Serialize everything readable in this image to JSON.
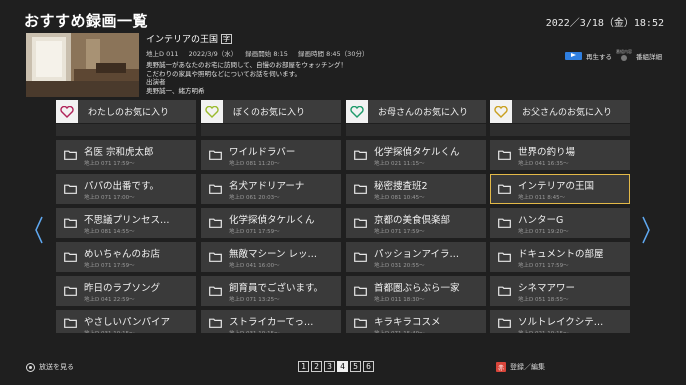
{
  "header": {
    "title": "おすすめ録画一覧",
    "datetime": "2022／3/18（金）18:52"
  },
  "program": {
    "title": "インテリアの王国",
    "badge": "字",
    "channel": "地上D 011",
    "date": "2022/3/9（水）",
    "start": "録画開始 8:15",
    "end": "録画時間 8:45（30分）",
    "desc": [
      "奥野誠一があなたのお宅に訪問して、自慢のお部屋をウォッチング！",
      "こだわりの家具や照明などについてお話を伺います。",
      "出演者",
      "奥野誠一、緒方明希"
    ]
  },
  "actions": {
    "play_label": "再生する",
    "sub_small": "番組内容",
    "detail_label": "番組詳細"
  },
  "columns": [
    {
      "header": "わたしのお気に入り",
      "heart_color": "#b0245a",
      "items": [
        {
          "name": "名医 宗和虎太郎",
          "sub": "地上D 071 17:59～"
        },
        {
          "name": "パパの出番です。",
          "sub": "地上D 071 17:00～"
        },
        {
          "name": "不思議プリンセス…",
          "sub": "地上D 081 14:55～"
        },
        {
          "name": "めいちゃんのお店",
          "sub": "地上D 071 17:59～"
        },
        {
          "name": "昨日のラブソング",
          "sub": "地上D 041 22:59～"
        },
        {
          "name": "やさしいパンパイア",
          "sub": "地上D 031 10:15～"
        }
      ]
    },
    {
      "header": "ぼくのお気に入り",
      "heart_color": "#9bbb2e",
      "items": [
        {
          "name": "ワイルドラバー",
          "sub": "地上D 081 11:20～"
        },
        {
          "name": "名犬アドリアーナ",
          "sub": "地上D 061 20:03～"
        },
        {
          "name": "化学探偵タケルくん",
          "sub": "地上D 071 17:59～"
        },
        {
          "name": "無敵マシーン レッ…",
          "sub": "地上D 041 16:00～"
        },
        {
          "name": "飼育員でございます。",
          "sub": "地上D 071 13:25～"
        },
        {
          "name": "ストライカーてっ…",
          "sub": "地上D 031 10:15～"
        }
      ]
    },
    {
      "header": "お母さんのお気に入り",
      "heart_color": "#1e9a6a",
      "items": [
        {
          "name": "化学探偵タケルくん",
          "sub": "地上D 021 11:15～"
        },
        {
          "name": "秘密捜査班2",
          "sub": "地上D 081 10:45～"
        },
        {
          "name": "京都の美食倶楽部",
          "sub": "地上D 071 17:59～"
        },
        {
          "name": "パッションアイラ…",
          "sub": "地上D 031 20:55～"
        },
        {
          "name": "首都圏ぶらぶら一家",
          "sub": "地上D 011 18:30～"
        },
        {
          "name": "キラキラコスメ",
          "sub": "地上D 071 15:40～"
        }
      ]
    },
    {
      "header": "お父さんのお気に入り",
      "heart_color": "#c9a020",
      "items": [
        {
          "name": "世界の釣り場",
          "sub": "地上D 041 16:35～"
        },
        {
          "name": "インテリアの王国",
          "sub": "地上D 011 8:45～",
          "selected": true
        },
        {
          "name": "ハンターG",
          "sub": "地上D 071 19:20～"
        },
        {
          "name": "ドキュメントの部屋",
          "sub": "地上D 071 17:59～"
        },
        {
          "name": "シネマアワー",
          "sub": "地上D 051 18:55～"
        },
        {
          "name": "ソルトレイクシテ…",
          "sub": "地上D 021 10:15～"
        }
      ]
    }
  ],
  "footer": {
    "left_label": "放送を見る",
    "pages": [
      "1",
      "2",
      "3",
      "4",
      "5",
      "6"
    ],
    "active_page": "4",
    "right_label": "登録／編集",
    "right_key": "赤"
  },
  "colors": {
    "selected_outline": "#e3b948",
    "blue_key": "#2f7fe0",
    "red_key": "#d9453a"
  }
}
